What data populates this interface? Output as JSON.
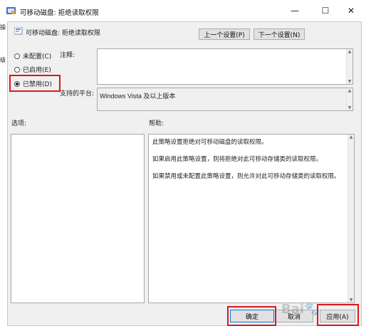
{
  "window": {
    "title": "可移动磁盘: 拒绝读取权限",
    "minimize_glyph": "—",
    "maximize_glyph": "☐",
    "close_glyph": "✕"
  },
  "header": {
    "policy_title": "可移动磁盘: 拒绝读取权限",
    "prev_label": "上一个设置(P)",
    "next_label": "下一个设置(N)"
  },
  "left_edge_chars": [
    "操",
    "级"
  ],
  "options": {
    "not_configured": "未配置(C)",
    "enabled": "已启用(E)",
    "disabled": "已禁用(D)",
    "selected": "disabled"
  },
  "comment": {
    "label": "注释:",
    "value": ""
  },
  "platform": {
    "label": "支持的平台:",
    "value": "Windows Vista 及以上版本"
  },
  "sections": {
    "options_label": "选项:",
    "help_label": "帮助:"
  },
  "help": {
    "paragraphs": [
      "此策略设置拒绝对可移动磁盘的读取权限。",
      "如果启用此策略设置，则将拒绝对此可移动存储类的读取权限。",
      "如果禁用或未配置此策略设置，则允许对此可移动存储类的读取权限。"
    ]
  },
  "footer": {
    "ok_label": "确定",
    "cancel_label": "取消",
    "apply_label": "应用(A)"
  },
  "colors": {
    "highlight_red": "#e0141e",
    "dialog_bg": "#f0f0f0"
  }
}
